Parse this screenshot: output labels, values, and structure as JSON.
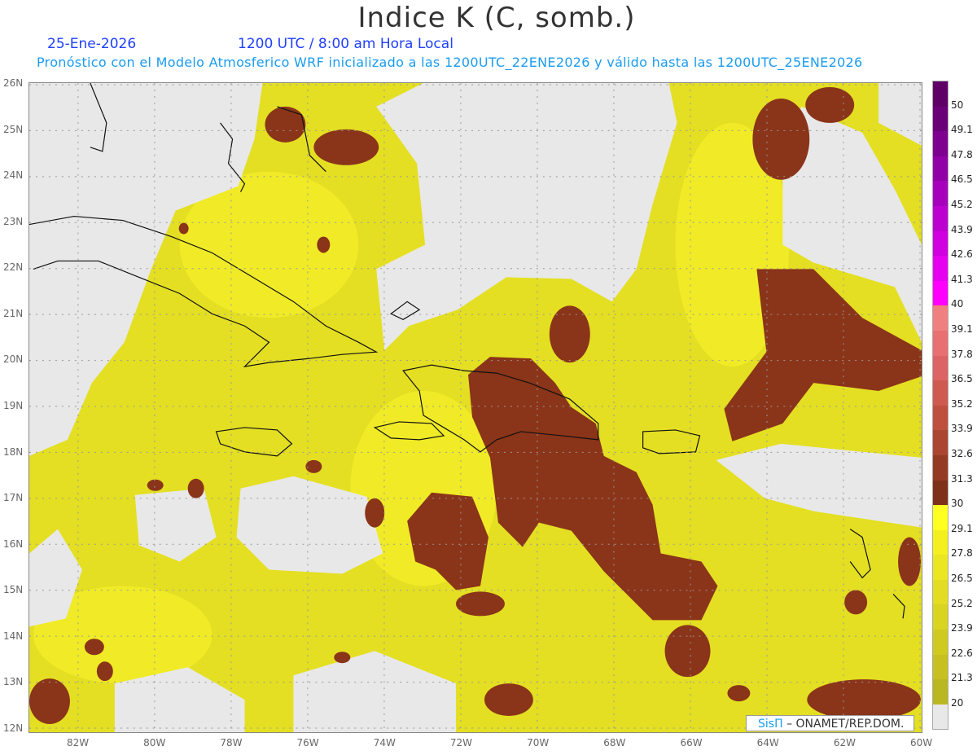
{
  "header": {
    "title": "Indice K (C, somb.)",
    "date": "25-Ene-2026",
    "time": "1200 UTC / 8:00 am Hora Local",
    "subtitle": "Pronóstico con el Modelo Atmosferico WRF inicializado a las 1200UTC_22ENE2026 y válido hasta las  1200UTC_25ENE2026"
  },
  "axes": {
    "lat_labels": [
      "26N",
      "25N",
      "24N",
      "23N",
      "22N",
      "21N",
      "20N",
      "19N",
      "18N",
      "17N",
      "16N",
      "15N",
      "14N",
      "13N",
      "12N"
    ],
    "lon_labels": [
      "82W",
      "80W",
      "78W",
      "76W",
      "74W",
      "72W",
      "70W",
      "68W",
      "66W",
      "64W",
      "62W",
      "60W"
    ]
  },
  "colorbar": {
    "labels": [
      "50",
      "49.1",
      "47.8",
      "46.5",
      "45.2",
      "43.9",
      "42.6",
      "41.3",
      "40",
      "39.1",
      "37.8",
      "36.5",
      "35.2",
      "33.9",
      "32.6",
      "31.3",
      "30",
      "29.1",
      "27.8",
      "26.5",
      "25.2",
      "23.9",
      "22.6",
      "21.3",
      "20"
    ],
    "colors": [
      "#5e0066",
      "#6a0078",
      "#7d0090",
      "#9000a6",
      "#a600bc",
      "#bc00d0",
      "#d000e0",
      "#e600f0",
      "#ff00ff",
      "#f08080",
      "#e87070",
      "#dc6464",
      "#cf5a50",
      "#bf5040",
      "#aa4632",
      "#953a24",
      "#7e3018",
      "#ffff20",
      "#f4f020",
      "#eae622",
      "#e2dc22",
      "#d8d420",
      "#cfca20",
      "#c6c020",
      "#bab822",
      "#e8e8e8"
    ]
  },
  "credit": {
    "brand": "SisΠ",
    "text": "– ONAMET/REP.DOM."
  }
}
